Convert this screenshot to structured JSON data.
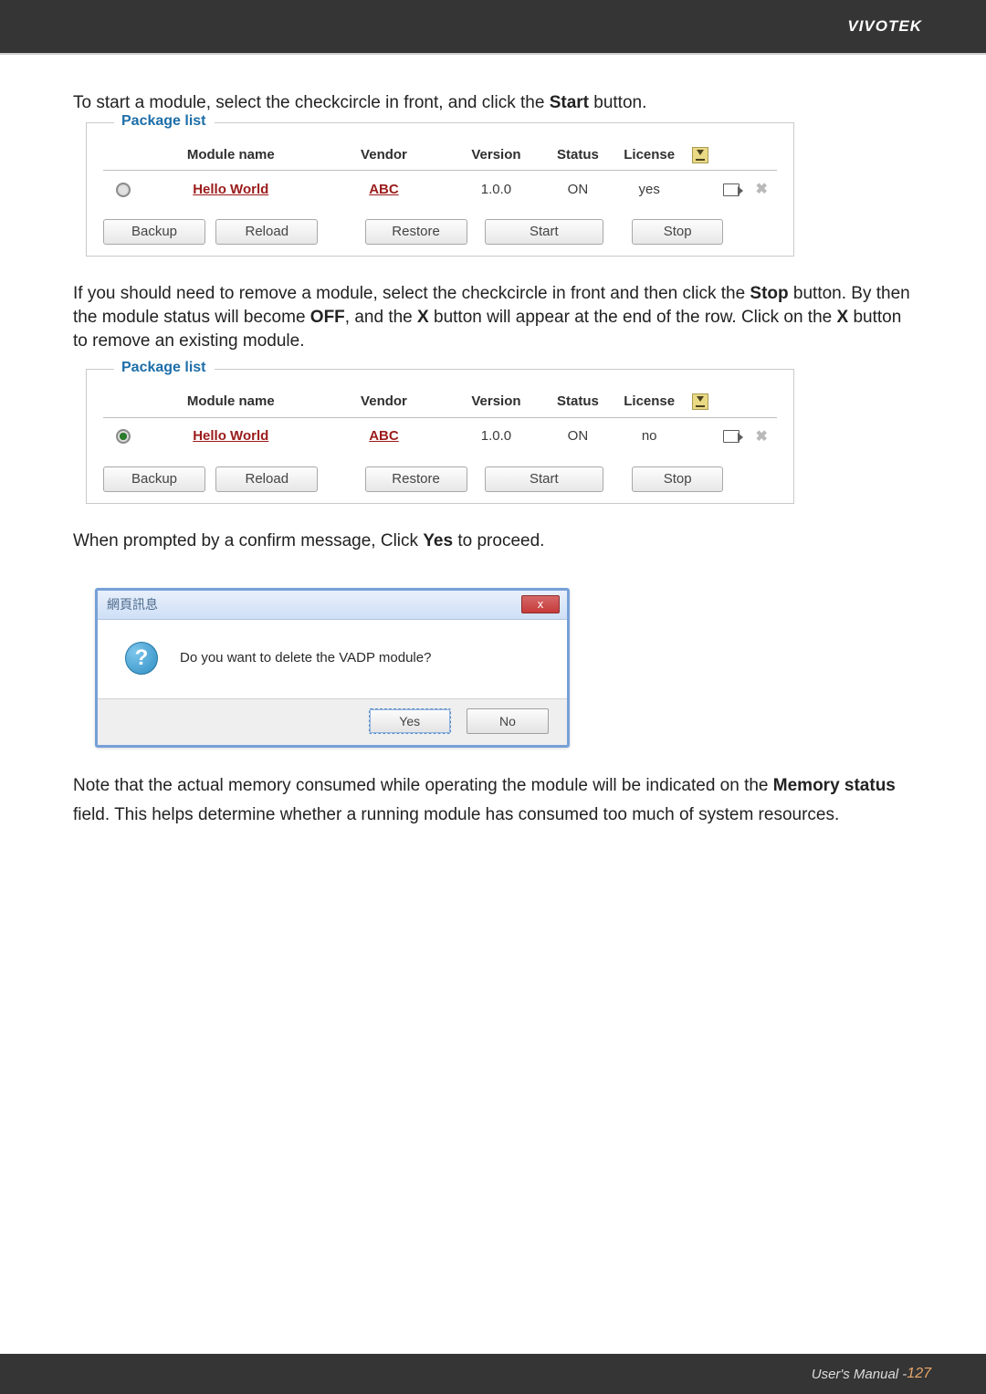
{
  "brand": "VIVOTEK",
  "para1_pre": "To start a module, select the checkcircle in front, and click the ",
  "para1_bold": "Start",
  "para1_post": " button.",
  "panel1": {
    "legend": "Package list",
    "headers": {
      "module": "Module name",
      "vendor": "Vendor",
      "version": "Version",
      "status": "Status",
      "license": "License"
    },
    "row": {
      "module": "Hello World",
      "vendor": "ABC",
      "version": "1.0.0",
      "status": "ON",
      "license": "yes"
    },
    "buttons": {
      "backup": "Backup",
      "reload": "Reload",
      "restore": "Restore",
      "start": "Start",
      "stop": "Stop"
    }
  },
  "para2_a": "If you should need to remove a module, select the checkcircle in front and then click the ",
  "para2_b": "Stop",
  "para2_c": " button. By then the module status will become ",
  "para2_d": "OFF",
  "para2_e": ", and the ",
  "para2_f": "X",
  "para2_g": " button will appear at the end of the row. Click on the ",
  "para2_h": "X",
  "para2_i": " button to remove an existing module.",
  "panel2": {
    "legend": "Package list",
    "headers": {
      "module": "Module name",
      "vendor": "Vendor",
      "version": "Version",
      "status": "Status",
      "license": "License"
    },
    "row": {
      "module": "Hello World",
      "vendor": "ABC",
      "version": "1.0.0",
      "status": "ON",
      "license": "no"
    },
    "buttons": {
      "backup": "Backup",
      "reload": "Reload",
      "restore": "Restore",
      "start": "Start",
      "stop": "Stop"
    }
  },
  "para3_a": "When prompted by a confirm message, Click ",
  "para3_b": "Yes",
  "para3_c": " to proceed.",
  "dialog": {
    "title": "網頁訊息",
    "close_x": "x",
    "q": "?",
    "message": "Do you want to delete the VADP module?",
    "yes": "Yes",
    "no": "No"
  },
  "para4_a": "Note that the actual memory consumed while operating the module will be indicated on the ",
  "para4_b": "Memory status",
  "para4_c": " field. This helps determine whether a running module has consumed too much of system resources.",
  "footer": {
    "label": "User's Manual - ",
    "page": "127"
  }
}
